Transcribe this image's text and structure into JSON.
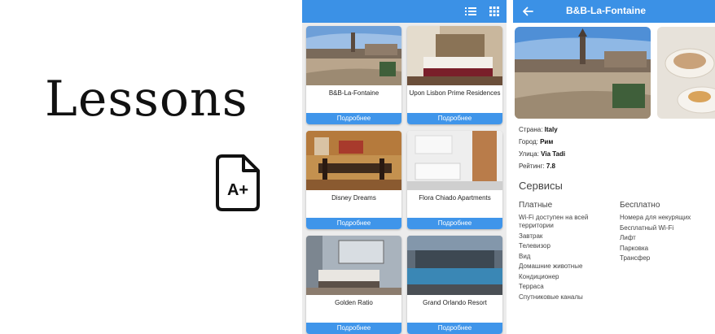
{
  "brand": {
    "title": "Lessons",
    "icon_label": "A+",
    "icon": "file-grade-icon"
  },
  "list_screen": {
    "toolbar": {
      "list_view_icon": "list-icon",
      "grid_view_icon": "grid-icon"
    },
    "more_label": "Подробнее",
    "hotels": [
      {
        "name": "B&B-La-Fontaine",
        "photo": "town-square-photo"
      },
      {
        "name": "Upon Lisbon Prime Residences",
        "photo": "hotel-bedroom-photo"
      },
      {
        "name": "Disney Dreams",
        "photo": "dining-room-photo"
      },
      {
        "name": "Flora Chiado Apartments",
        "photo": "white-kitchen-photo"
      },
      {
        "name": "Golden Ratio",
        "photo": "modern-bedroom-photo"
      },
      {
        "name": "Grand Orlando Resort",
        "photo": "pool-terrace-photo"
      }
    ]
  },
  "detail_screen": {
    "title": "B&B-La-Fontaine",
    "back_icon": "arrow-left-icon",
    "info": {
      "country_label": "Страна: ",
      "country": "Italy",
      "city_label": "Город: ",
      "city": "Рим",
      "street_label": "Улица: ",
      "street": "Via Tadi",
      "rating_label": "Рейтинг: ",
      "rating": "7.8"
    },
    "services_title": "Сервисы",
    "paid": {
      "title": "Платные",
      "items": [
        "Wi-Fi доступен на всей территории",
        "Завтрак",
        "Телевизор",
        "Вид",
        "Домашние животные",
        "Кондиционер",
        "Терраса",
        "Спутниковые каналы"
      ]
    },
    "free": {
      "title": "Бесплатно",
      "items": [
        "Номера для некурящих",
        "Бесплатный Wi-Fi",
        "Лифт",
        "Парковка",
        "Трансфер"
      ]
    }
  },
  "colors": {
    "appbar": "#3b91e6",
    "button": "#3f95ea",
    "list_background": "#ececec"
  }
}
